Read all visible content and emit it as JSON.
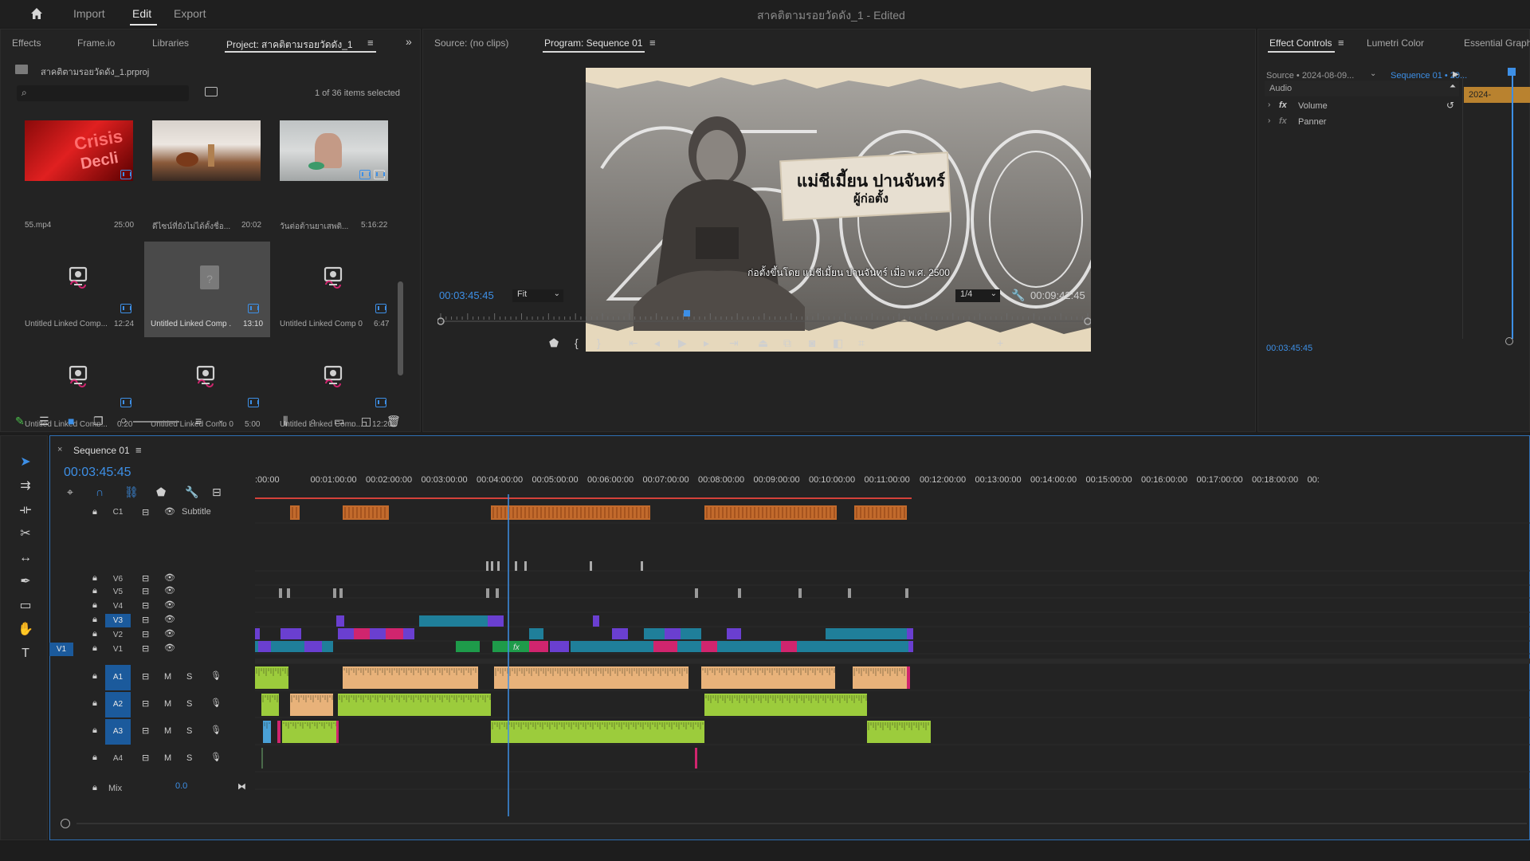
{
  "menu": {
    "home_icon": "home-icon",
    "items": [
      "Import",
      "Edit",
      "Export"
    ],
    "active": "Edit",
    "title": "สาคติตามรอยวัดดัง_1",
    "title_suffix": "- Edited"
  },
  "project_panel": {
    "tabs": [
      "Effects",
      "Frame.io",
      "Libraries",
      "Project: สาคติตามรอยวัดดัง_1"
    ],
    "active_tab": "Project: สาคติตามรอยวัดดัง_1",
    "file_name": "สาคติตามรอยวัดดัง_1.prproj",
    "selection_status": "1 of 36 items selected",
    "items": [
      {
        "name": "55.mp4",
        "duration": "25:00",
        "kind": "video"
      },
      {
        "name": "ดีไซน์ที่ยังไม่ได้ตั้งชื่อ...",
        "duration": "20:02",
        "kind": "video"
      },
      {
        "name": "วันต่อต้านยาเสพติ...",
        "duration": "5:16:22",
        "kind": "video"
      },
      {
        "name": "Untitled Linked Comp...",
        "duration": "12:24",
        "kind": "linked"
      },
      {
        "name": "Untitled Linked Comp ...",
        "duration": "13:10",
        "kind": "missing"
      },
      {
        "name": "Untitled Linked Comp 0...",
        "duration": "6:47",
        "kind": "linked"
      },
      {
        "name": "Untitled Linked Comp...",
        "duration": "0:20",
        "kind": "linked"
      },
      {
        "name": "Untitled Linked Comp 0...",
        "duration": "5:00",
        "kind": "linked"
      },
      {
        "name": "Untitled Linked Comp...",
        "duration": "12:20",
        "kind": "linked"
      }
    ]
  },
  "monitor": {
    "source_tab": "Source: (no clips)",
    "program_tab": "Program: Sequence 01",
    "video_title_line1": "แม่ชีเมี้ยน ปานจันทร์",
    "video_title_line2": "ผู้ก่อตั้ง",
    "video_big_number": "2500",
    "video_subtitle": "ก่อตั้งขึ้นโดย แม่ชีเมี้ยน ปานจันทร์ เมื่อ พ.ศ. 2500",
    "current_time": "00:03:45:45",
    "fit": "Fit",
    "resolution": "1/4",
    "duration": "00:09:42:45",
    "playhead_fraction": 0.38
  },
  "effect_controls": {
    "tabs": [
      "Effect Controls",
      "Lumetri Color",
      "Essential Graph"
    ],
    "active_tab": "Effect Controls",
    "source_label": "Source • 2024-08-09...",
    "sequence_label": "Sequence 01 • 20...",
    "section": "Audio",
    "effects": [
      "Volume",
      "Panner"
    ],
    "mini_clip_label": "2024-",
    "timecode": "00:03:45:45"
  },
  "timeline": {
    "sequence_name": "Sequence 01",
    "timecode": "00:03:45:45",
    "ruler": [
      ":00:00",
      "00:01:00:00",
      "00:02:00:00",
      "00:03:00:00",
      "00:04:00:00",
      "00:05:00:00",
      "00:06:00:00",
      "00:07:00:00",
      "00:08:00:00",
      "00:09:00:00",
      "00:10:00:00",
      "00:11:00:00",
      "00:12:00:00",
      "00:13:00:00",
      "00:14:00:00",
      "00:15:00:00",
      "00:16:00:00",
      "00:17:00:00",
      "00:18:00:00",
      "00:"
    ],
    "subtitle_track": {
      "label": "C1",
      "name": "Subtitle"
    },
    "video_tracks": [
      "V6",
      "V5",
      "V4",
      "V3",
      "V2",
      "V1"
    ],
    "audio_tracks": [
      "A1",
      "A2",
      "A3",
      "A4"
    ],
    "source_patch": "V1",
    "mix_label": "Mix",
    "mix_value": "0.0",
    "mute_label": "M",
    "solo_label": "S",
    "fx_label": "fx"
  },
  "tools": [
    "selection-tool",
    "track-select-tool",
    "ripple-edit-tool",
    "razor-tool",
    "slip-tool",
    "pen-tool",
    "rectangle-tool",
    "hand-tool",
    "type-tool"
  ],
  "colors": {
    "accent_blue": "#3d8fe6",
    "subtitle_clip": "#c26a2c",
    "audio_orange": "#e8b27a",
    "audio_green": "#9ccc3c",
    "video_purple": "#6a3fd0",
    "video_teal": "#1f7f9a",
    "video_pink": "#d0256e",
    "video_green": "#1e9b4a"
  }
}
